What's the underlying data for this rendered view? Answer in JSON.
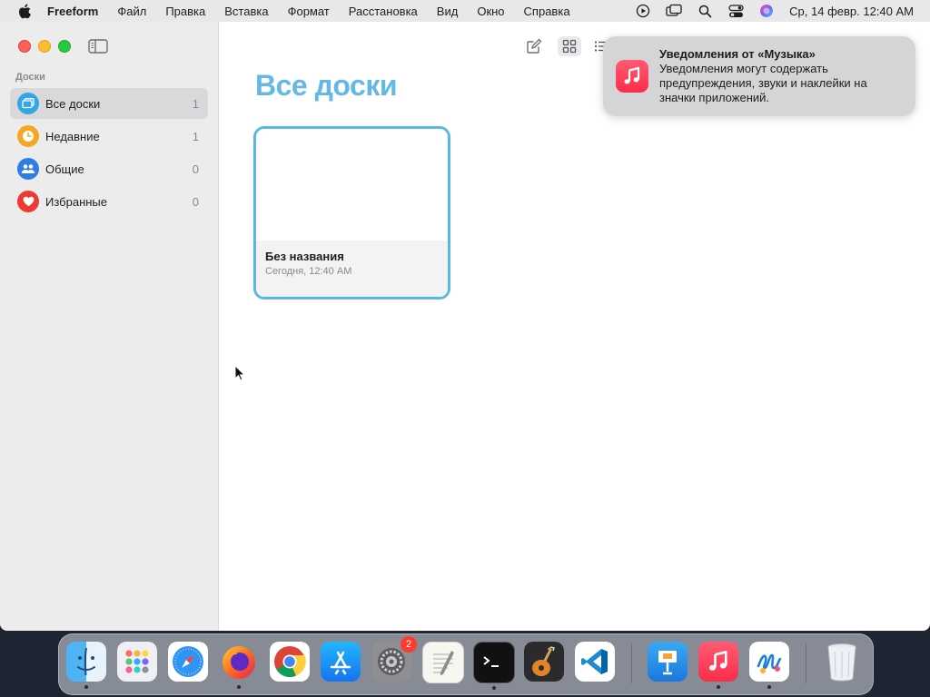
{
  "menubar": {
    "app_name": "Freeform",
    "items": [
      "Файл",
      "Правка",
      "Вставка",
      "Формат",
      "Расстановка",
      "Вид",
      "Окно",
      "Справка"
    ],
    "clock": "Ср, 14 февр.  12:40 AM"
  },
  "sidebar": {
    "section_label": "Доски",
    "items": [
      {
        "label": "Все доски",
        "count": "1",
        "icon": "all-boards-icon",
        "color": "#33a6e5"
      },
      {
        "label": "Недавние",
        "count": "1",
        "icon": "clock-icon",
        "color": "#f5a623"
      },
      {
        "label": "Общие",
        "count": "0",
        "icon": "people-icon",
        "color": "#2f7de1"
      },
      {
        "label": "Избранные",
        "count": "0",
        "icon": "heart-icon",
        "color": "#ef3a33"
      }
    ]
  },
  "main": {
    "title": "Все доски",
    "boards": [
      {
        "name": "Без названия",
        "date": "Сегодня, 12:40 AM"
      }
    ]
  },
  "notification": {
    "title": "Уведомления от «Музыка»",
    "body": "Уведомления могут содержать предупреждения, звуки и наклейки на значки приложений.",
    "icon": "music-icon"
  },
  "dock": {
    "apps": [
      "finder",
      "launchpad",
      "safari",
      "firefox",
      "chrome",
      "app-store",
      "system-settings",
      "textedit",
      "terminal",
      "garageband",
      "vscode",
      "keynote",
      "music",
      "freeform",
      "trash"
    ],
    "settings_badge": "2"
  },
  "colors": {
    "accent": "#5ab9e3",
    "title": "#63b9e4"
  }
}
